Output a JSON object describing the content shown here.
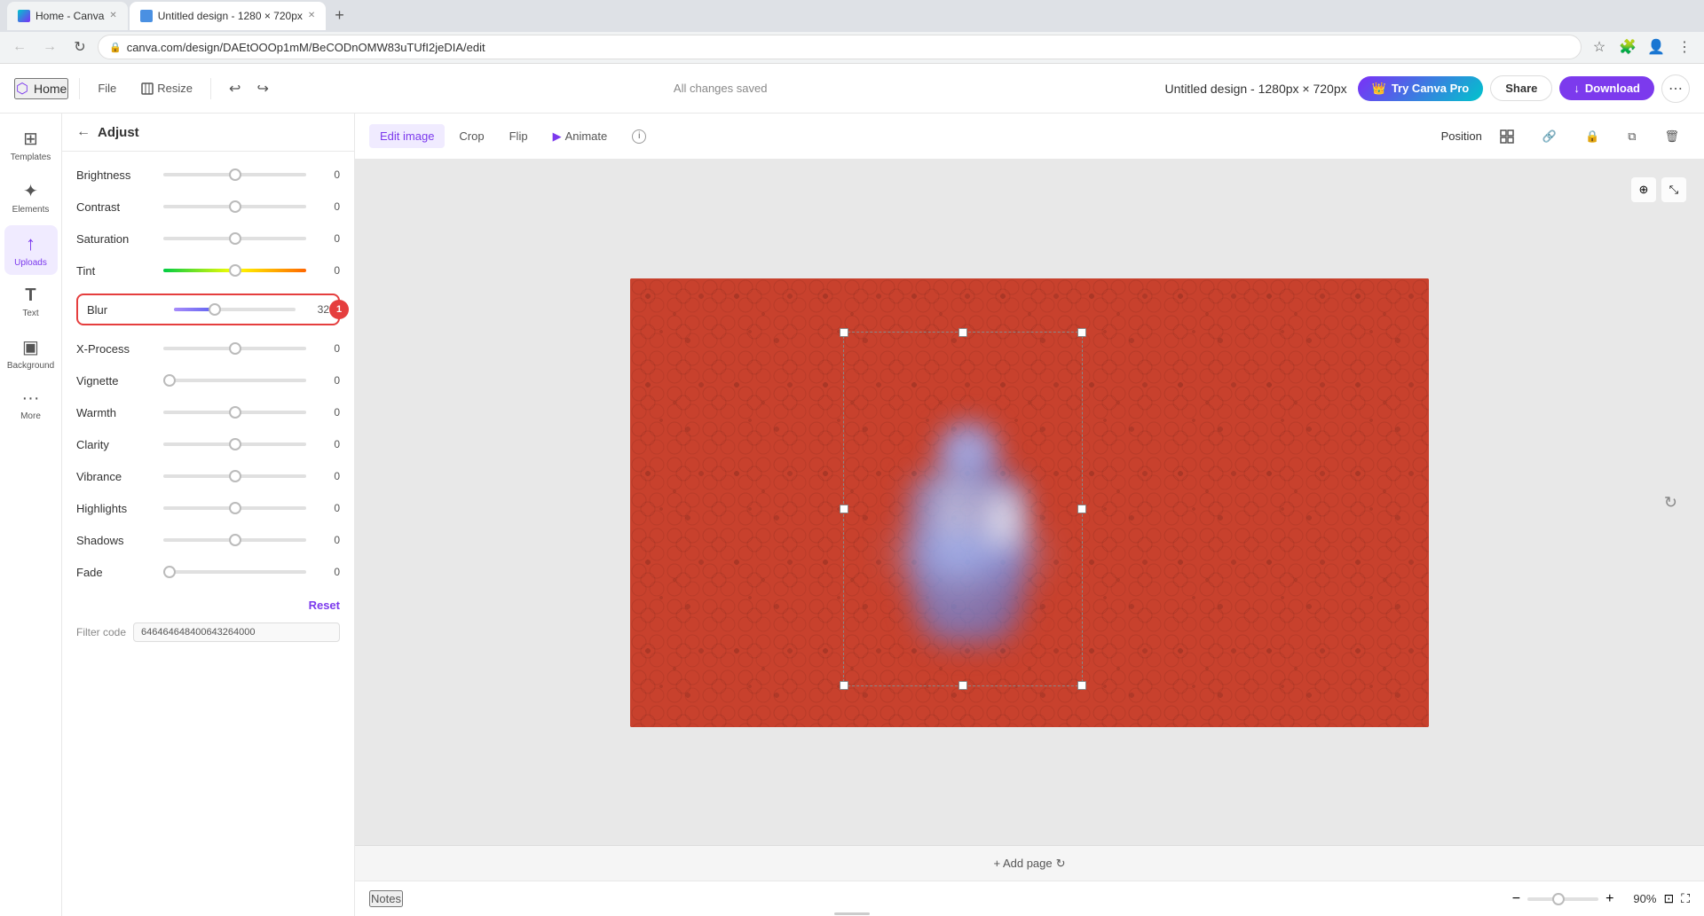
{
  "browser": {
    "tabs": [
      {
        "label": "Home - Canva",
        "active": false,
        "favicon": "canva"
      },
      {
        "label": "Untitled design - 1280 × 720px",
        "active": true,
        "favicon": "design"
      }
    ],
    "address": "canva.com/design/DAEtOOOp1mM/BeCODnOMW83uTUfI2jeDIA/edit"
  },
  "toolbar": {
    "home_label": "Home",
    "file_label": "File",
    "resize_label": "Resize",
    "saved_status": "All changes saved",
    "design_title": "Untitled design - 1280px × 720px",
    "try_pro_label": "Try Canva Pro",
    "share_label": "Share",
    "download_label": "Download",
    "more_icon": "⋯"
  },
  "secondary_toolbar": {
    "edit_image_label": "Edit image",
    "crop_label": "Crop",
    "flip_label": "Flip",
    "animate_label": "Animate",
    "position_label": "Position"
  },
  "sidebar": {
    "items": [
      {
        "label": "Templates",
        "icon": "⊞"
      },
      {
        "label": "Elements",
        "icon": "✦"
      },
      {
        "label": "Uploads",
        "icon": "↑"
      },
      {
        "label": "Text",
        "icon": "T"
      },
      {
        "label": "Background",
        "icon": "▣"
      },
      {
        "label": "More",
        "icon": "···"
      }
    ]
  },
  "adjust_panel": {
    "title": "Adjust",
    "sliders": [
      {
        "label": "Brightness",
        "value": 0,
        "min": -100,
        "max": 100,
        "percent": 50
      },
      {
        "label": "Contrast",
        "value": 0,
        "min": -100,
        "max": 100,
        "percent": 50
      },
      {
        "label": "Saturation",
        "value": 0,
        "min": -100,
        "max": 100,
        "percent": 50
      },
      {
        "label": "Tint",
        "value": 0,
        "min": -100,
        "max": 100,
        "percent": 50,
        "special": "tint"
      },
      {
        "label": "Blur",
        "value": 32,
        "min": 0,
        "max": 100,
        "percent": 32,
        "special": "blur"
      },
      {
        "label": "X-Process",
        "value": 0,
        "min": -100,
        "max": 100,
        "percent": 50
      },
      {
        "label": "Vignette",
        "value": 0,
        "min": 0,
        "max": 100,
        "percent": 0
      },
      {
        "label": "Warmth",
        "value": 0,
        "min": -100,
        "max": 100,
        "percent": 50
      },
      {
        "label": "Clarity",
        "value": 0,
        "min": -100,
        "max": 100,
        "percent": 50
      },
      {
        "label": "Vibrance",
        "value": 0,
        "min": -100,
        "max": 100,
        "percent": 50
      },
      {
        "label": "Highlights",
        "value": 0,
        "min": -100,
        "max": 100,
        "percent": 50
      },
      {
        "label": "Shadows",
        "value": 0,
        "min": -100,
        "max": 100,
        "percent": 50
      },
      {
        "label": "Fade",
        "value": 0,
        "min": 0,
        "max": 100,
        "percent": 0
      }
    ],
    "reset_label": "Reset",
    "filter_code_label": "Filter code",
    "filter_code_value": "646464648400643264000"
  },
  "canvas": {
    "add_page_label": "+ Add page"
  },
  "status_bar": {
    "notes_label": "Notes",
    "zoom_value": 90,
    "zoom_label": "90%"
  }
}
